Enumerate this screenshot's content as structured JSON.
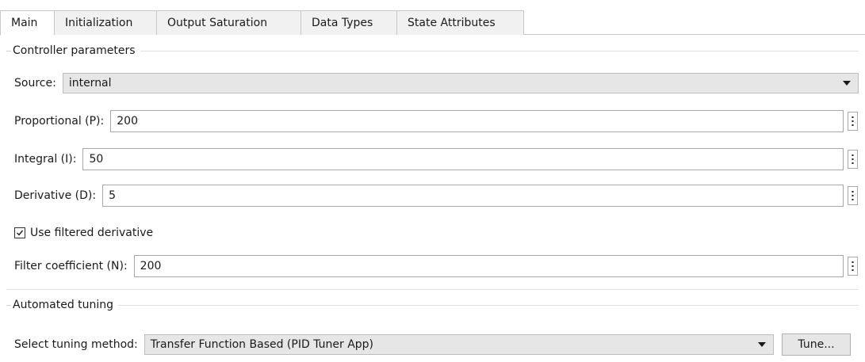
{
  "tabs": [
    {
      "label": "Main",
      "active": true
    },
    {
      "label": "Initialization",
      "active": false
    },
    {
      "label": "Output Saturation",
      "active": false
    },
    {
      "label": "Data Types",
      "active": false
    },
    {
      "label": "State Attributes",
      "active": false
    }
  ],
  "controller_params": {
    "header": "Controller parameters",
    "source": {
      "label": "Source:",
      "value": "internal"
    },
    "proportional": {
      "label": "Proportional (P):",
      "value": "200"
    },
    "integral": {
      "label": "Integral (I):",
      "value": "50"
    },
    "derivative": {
      "label": "Derivative (D):",
      "value": "5"
    },
    "use_filtered_derivative": {
      "label": "Use filtered derivative",
      "checked": true
    },
    "filter_coefficient": {
      "label": "Filter coefficient (N):",
      "value": "200"
    }
  },
  "automated_tuning": {
    "header": "Automated tuning",
    "method": {
      "label": "Select tuning method:",
      "value": "Transfer Function Based (PID Tuner App)"
    },
    "tune_button": "Tune..."
  },
  "icons": {
    "dropdown": "caret-down-icon",
    "parameter_menu": "vertical-ellipsis-icon",
    "checkbox": "checkmark-icon"
  },
  "colors": {
    "dropdown_bg": "#e6e6e6",
    "tab_bg": "#f1f1f1",
    "border": "#a8a8a8"
  }
}
